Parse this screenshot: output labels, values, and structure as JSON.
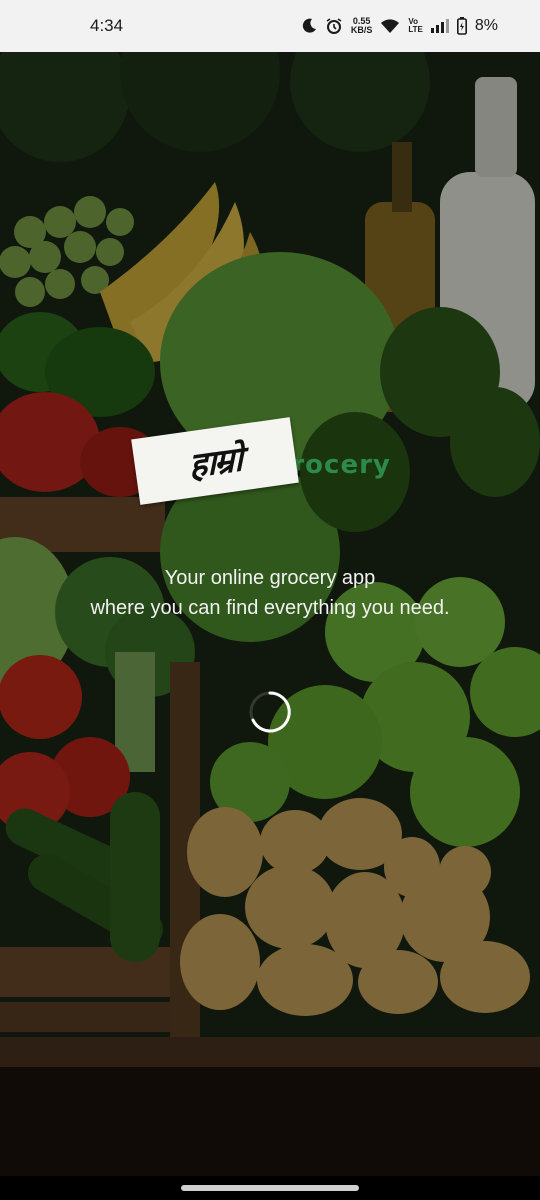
{
  "status_bar": {
    "time": "4:34",
    "net_speed_value": "0.55",
    "net_speed_unit": "KB/S",
    "lte_top": "Vo",
    "lte_bottom": "LTE",
    "battery_percent": "8%",
    "icons": [
      "moon-icon",
      "alarm-icon",
      "wifi-icon",
      "signal-icon",
      "battery-icon"
    ]
  },
  "splash": {
    "logo_text": "Grocery",
    "logo_mark_text": "हाम्रो",
    "tagline_line1": "Your online grocery app",
    "tagline_line2": "where you can find everything you need.",
    "loading": true
  },
  "colors": {
    "brand_green": "#2e8a4a",
    "status_bar_bg": "#f2f2f2"
  }
}
